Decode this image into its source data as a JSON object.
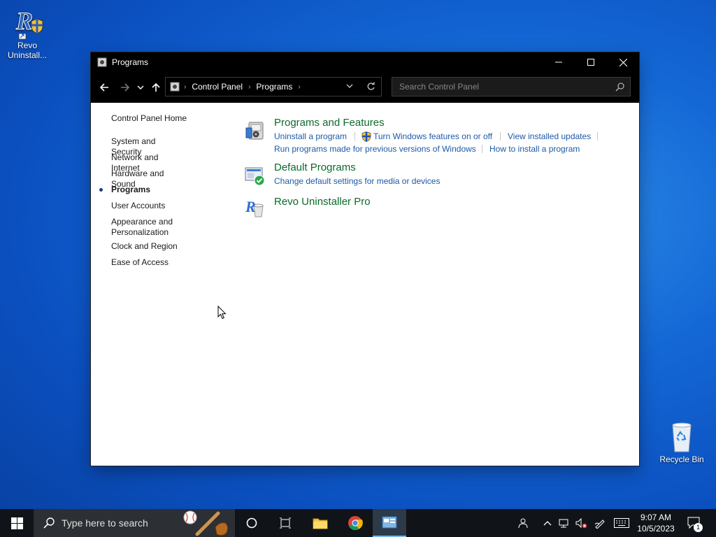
{
  "desktop": {
    "revo_icon_label": "Revo Uninstall...",
    "recycle_bin_label": "Recycle Bin"
  },
  "window": {
    "title": "Programs",
    "address": {
      "crumbs": [
        "Control Panel",
        "Programs"
      ]
    },
    "search": {
      "placeholder": "Search Control Panel"
    }
  },
  "sidebar": {
    "items": [
      {
        "label": "Control Panel Home"
      },
      {
        "label": "System and Security"
      },
      {
        "label": "Network and Internet"
      },
      {
        "label": "Hardware and Sound"
      },
      {
        "label": "Programs",
        "active": true
      },
      {
        "label": "User Accounts"
      },
      {
        "label": "Appearance and Personalization"
      },
      {
        "label": "Clock and Region"
      },
      {
        "label": "Ease of Access"
      }
    ]
  },
  "categories": {
    "programs_features": {
      "title": "Programs and Features",
      "links": [
        "Uninstall a program",
        "Turn Windows features on or off",
        "View installed updates",
        "Run programs made for previous versions of Windows",
        "How to install a program"
      ]
    },
    "default_programs": {
      "title": "Default Programs",
      "links": [
        "Change default settings for media or devices"
      ]
    },
    "revo": {
      "title": "Revo Uninstaller Pro"
    }
  },
  "taskbar": {
    "search_placeholder": "Type here to search",
    "time": "9:07 AM",
    "date": "10/5/2023",
    "notification_count": "1"
  },
  "colors": {
    "link": "#1c5aa8",
    "category_title": "#0b6a2b",
    "taskbar": "#101418"
  }
}
